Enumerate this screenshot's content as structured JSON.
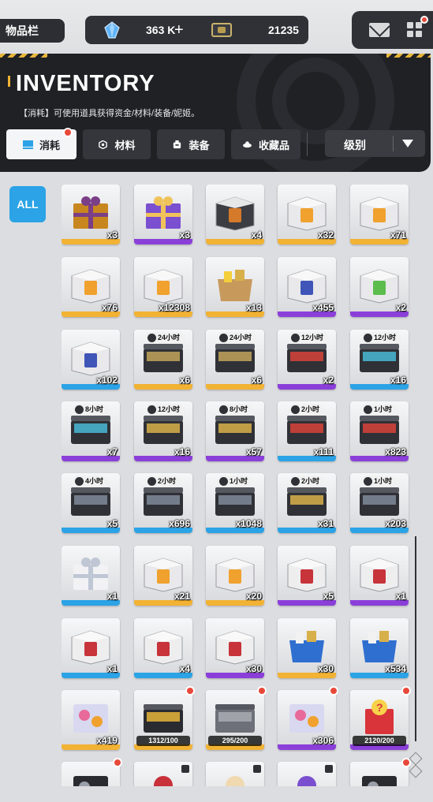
{
  "header": {
    "title_chip": "物品栏",
    "gems": "363 K",
    "tickets": "21235 K",
    "plus": "+"
  },
  "panel": {
    "title": "INVENTORY",
    "description": "【消耗】可使用道具获得资金/材料/装备/妮姬。",
    "tabs": [
      {
        "label": "消耗",
        "active": true
      },
      {
        "label": "材料",
        "active": false
      },
      {
        "label": "装备",
        "active": false
      },
      {
        "label": "收藏品",
        "active": false
      }
    ],
    "sort_select": "级别"
  },
  "sidebar": {
    "all_label": "ALL"
  },
  "colors": {
    "gold": "#f2b233",
    "purple": "#8b3fd9",
    "blue": "#2ba3e6",
    "accent_red": "#e8483a"
  },
  "items": [
    {
      "count": "x3",
      "rarity": "gold",
      "icon": "gift-box-gold-icon"
    },
    {
      "count": "x3",
      "rarity": "purple",
      "icon": "gift-box-purple-icon"
    },
    {
      "count": "x4",
      "rarity": "gold",
      "icon": "crate-dark-icon"
    },
    {
      "count": "x32",
      "rarity": "gold",
      "icon": "crate-orange-icon"
    },
    {
      "count": "x71",
      "rarity": "gold",
      "icon": "crate-orange-icon"
    },
    {
      "count": "x76",
      "rarity": "gold",
      "icon": "crate-orange-icon"
    },
    {
      "count": "x12308",
      "rarity": "gold",
      "icon": "crate-orange-icon"
    },
    {
      "count": "x13",
      "rarity": "gold",
      "icon": "cardboard-box-icon"
    },
    {
      "count": "x455",
      "rarity": "purple",
      "icon": "crate-blue-icon"
    },
    {
      "count": "x2",
      "rarity": "purple",
      "icon": "crate-green-icon"
    },
    {
      "count": "x102",
      "rarity": "blue",
      "icon": "crate-blue-icon"
    },
    {
      "count": "x6",
      "rarity": "gold",
      "icon": "case-stack-icon",
      "timer": "24小时"
    },
    {
      "count": "x6",
      "rarity": "gold",
      "icon": "case-stack-icon",
      "timer": "24小时"
    },
    {
      "count": "x2",
      "rarity": "purple",
      "icon": "case-red-icon",
      "timer": "12小时"
    },
    {
      "count": "x16",
      "rarity": "blue",
      "icon": "case-blue-icon",
      "timer": "12小时"
    },
    {
      "count": "x7",
      "rarity": "purple",
      "icon": "case-blue-icon",
      "timer": "8小时"
    },
    {
      "count": "x16",
      "rarity": "purple",
      "icon": "case-gold-icon",
      "timer": "12小时"
    },
    {
      "count": "x57",
      "rarity": "purple",
      "icon": "case-gold-icon",
      "timer": "8小时"
    },
    {
      "count": "x111",
      "rarity": "blue",
      "icon": "case-red-icon",
      "timer": "2小时"
    },
    {
      "count": "x823",
      "rarity": "purple",
      "icon": "case-red-icon",
      "timer": "1小时"
    },
    {
      "count": "x5",
      "rarity": "blue",
      "icon": "case-dark-icon",
      "timer": "4小时"
    },
    {
      "count": "x696",
      "rarity": "blue",
      "icon": "case-dark-icon",
      "timer": "2小时"
    },
    {
      "count": "x1048",
      "rarity": "blue",
      "icon": "case-dark-icon",
      "timer": "1小时"
    },
    {
      "count": "x31",
      "rarity": "blue",
      "icon": "case-gold-icon",
      "timer": "2小时"
    },
    {
      "count": "x203",
      "rarity": "blue",
      "icon": "case-dark-icon",
      "timer": "1小时"
    },
    {
      "count": "x1",
      "rarity": "blue",
      "icon": "gift-box-white-icon"
    },
    {
      "count": "x21",
      "rarity": "gold",
      "icon": "crate-orange-icon"
    },
    {
      "count": "x20",
      "rarity": "gold",
      "icon": "crate-orange-icon"
    },
    {
      "count": "x5",
      "rarity": "purple",
      "icon": "crate-red-icon"
    },
    {
      "count": "x1",
      "rarity": "purple",
      "icon": "crate-red-icon"
    },
    {
      "count": "x1",
      "rarity": "blue",
      "icon": "crate-red-icon"
    },
    {
      "count": "x4",
      "rarity": "blue",
      "icon": "crate-red-icon"
    },
    {
      "count": "x30",
      "rarity": "purple",
      "icon": "crate-red-icon"
    },
    {
      "count": "x30",
      "rarity": "gold",
      "icon": "bin-blue-icon"
    },
    {
      "count": "x534",
      "rarity": "blue",
      "icon": "bin-blue-icon"
    },
    {
      "count": "x419",
      "rarity": "gold",
      "icon": "pack-colorful-icon"
    },
    {
      "progress": "1312/100",
      "rarity": "gold",
      "icon": "case-trophy-icon",
      "dot": true
    },
    {
      "progress": "295/200",
      "rarity": "gold",
      "icon": "case-metal-icon",
      "dot": true
    },
    {
      "count": "x306",
      "rarity": "purple",
      "icon": "pack-colorful-icon",
      "dot": true
    },
    {
      "progress": "2120/200",
      "rarity": "purple",
      "icon": "mystery-box-icon",
      "dot": true
    },
    {
      "rarity": "gold",
      "icon": "card-dark-icon",
      "dot": true
    },
    {
      "rarity": "gold",
      "icon": "figure-red-icon",
      "lock": true
    },
    {
      "rarity": "gold",
      "icon": "figure-cream-icon",
      "lock": true
    },
    {
      "rarity": "purple",
      "icon": "figure-purple-icon",
      "lock": true
    },
    {
      "rarity": "gold",
      "icon": "card-dark-icon",
      "dot": true
    }
  ]
}
